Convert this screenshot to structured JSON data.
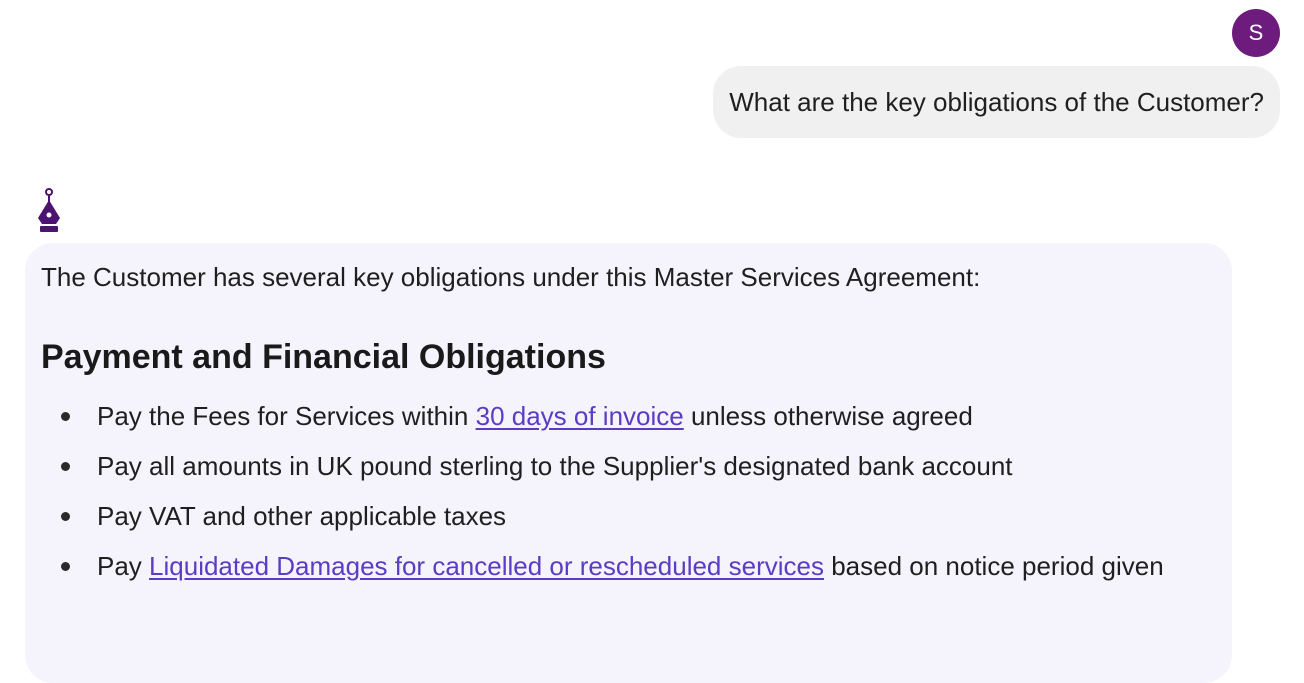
{
  "user": {
    "avatar_letter": "S",
    "message": "What are the key obligations of the Customer?"
  },
  "assistant": {
    "icon": "fountain-pen-nib-icon",
    "intro": "The Customer has several key obligations under this Master Services Agreement:",
    "heading": "Payment and Financial Obligations",
    "items": [
      {
        "before": "Pay the Fees for Services within ",
        "link": "30 days of invoice",
        "after": " unless otherwise agreed"
      },
      {
        "before": "Pay all amounts in UK pound sterling to the Supplier's designated bank account",
        "link": "",
        "after": ""
      },
      {
        "before": "Pay VAT and other applicable taxes",
        "link": "",
        "after": ""
      },
      {
        "before": "Pay ",
        "link": "Liquidated Damages for cancelled or rescheduled services",
        "after": " based on notice period given"
      }
    ]
  },
  "colors": {
    "avatar_bg": "#6e1b7e",
    "user_bubble_bg": "#f0f0f0",
    "assistant_bubble_bg": "#f5f3fc",
    "link": "#5b3cc4",
    "brand_icon": "#4a1470"
  }
}
